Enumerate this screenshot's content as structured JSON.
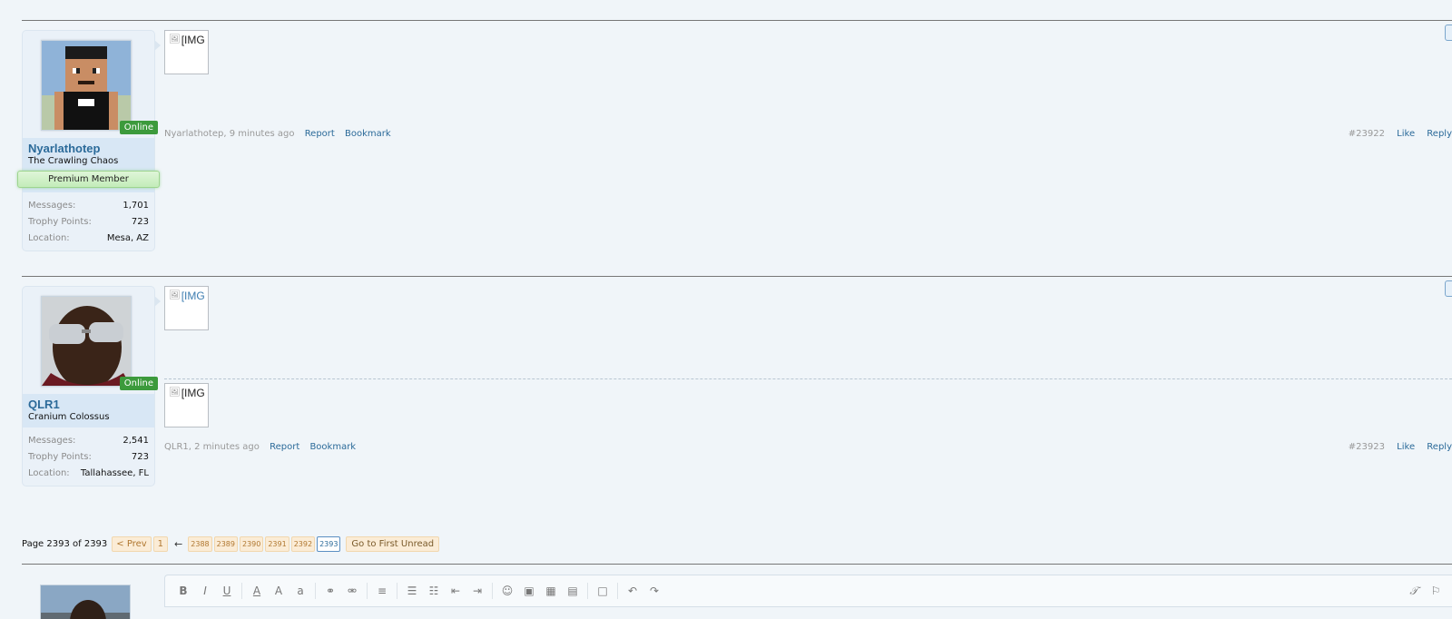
{
  "posts": [
    {
      "username": "Nyarlathotep",
      "user_title": "The Crawling Chaos",
      "online_label": "Online",
      "banner": "Premium Member",
      "stats": [
        {
          "label": "Messages:",
          "value": "1,701"
        },
        {
          "label": "Trophy Points:",
          "value": "723"
        },
        {
          "label": "Location:",
          "value": "Mesa, AZ"
        }
      ],
      "images": [
        "[IMG"
      ],
      "meta": "Nyarlathotep, 9 minutes ago",
      "report": "Report",
      "bookmark": "Bookmark",
      "post_number": "#23922",
      "like": "Like",
      "reply": "Reply"
    },
    {
      "username": "QLR1",
      "user_title": "Cranium Colossus",
      "online_label": "Online",
      "stats": [
        {
          "label": "Messages:",
          "value": "2,541"
        },
        {
          "label": "Trophy Points:",
          "value": "723"
        },
        {
          "label": "Location:",
          "value": "Tallahassee, FL"
        }
      ],
      "images": [
        "[IMG",
        "[IMG"
      ],
      "meta": "QLR1, 2 minutes ago",
      "report": "Report",
      "bookmark": "Bookmark",
      "post_number": "#23923",
      "like": "Like",
      "reply": "Reply"
    }
  ],
  "pagination": {
    "label": "Page 2393 of 2393",
    "prev": "< Prev",
    "first": "1",
    "arrow": "←",
    "pages": [
      "2388",
      "2389",
      "2390",
      "2391",
      "2392",
      "2393"
    ],
    "current": "2393",
    "first_unread": "Go to First Unread"
  },
  "editor": {
    "buttons": [
      "B",
      "I",
      "U",
      "A",
      "A",
      "a",
      "link",
      "unlink",
      "align",
      "ul",
      "ol",
      "outdent",
      "indent",
      "smilie",
      "image",
      "media",
      "code",
      "save",
      "undo",
      "redo",
      "remove-format",
      "bbcode"
    ]
  },
  "colors": {
    "online": "#3c9a3c",
    "link": "#2b6a99",
    "page_bg": "#f0f5f9"
  }
}
